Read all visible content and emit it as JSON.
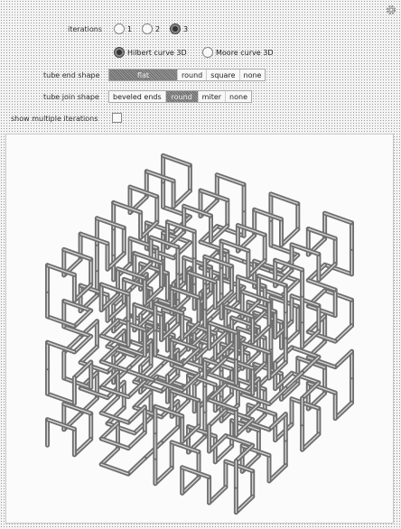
{
  "controls": {
    "iterations": {
      "label": "iterations",
      "options": [
        "1",
        "2",
        "3"
      ],
      "selected_index": 2
    },
    "curve_type": {
      "options": [
        "Hilbert curve 3D",
        "Moore curve 3D"
      ],
      "selected_index": 0
    },
    "tube_end_shape": {
      "label": "tube end shape",
      "options": [
        "flat",
        "round",
        "square",
        "none"
      ],
      "selected_index": 0
    },
    "tube_join_shape": {
      "label": "tube join shape",
      "options": [
        "beveled ends",
        "round",
        "miter",
        "none"
      ],
      "selected_index": 1
    },
    "show_multiple_iterations": {
      "label": "show multiple iterations",
      "checked": false
    }
  },
  "icons": {
    "settings": "gear-icon"
  },
  "colors": {
    "tube": "#6f6f6f",
    "tube_highlight": "#d8d8d8"
  }
}
